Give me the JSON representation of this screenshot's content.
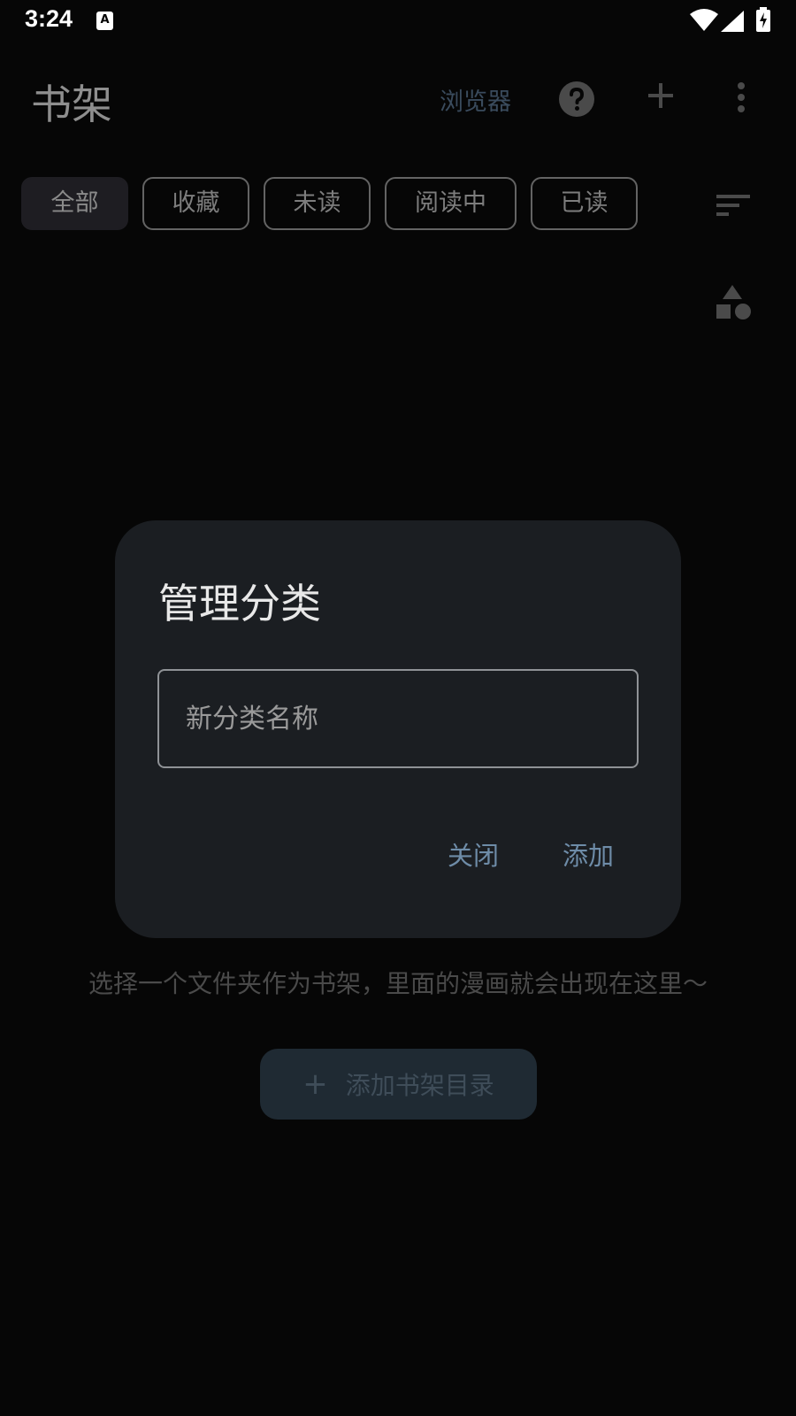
{
  "status_bar": {
    "time": "3:24",
    "notification_icon_letter": "A"
  },
  "app_bar": {
    "title": "书架",
    "browser_label": "浏览器",
    "icons": [
      "help-icon",
      "add-icon",
      "more-vert-icon"
    ]
  },
  "filters": {
    "chips": [
      {
        "label": "全部",
        "selected": true
      },
      {
        "label": "收藏",
        "selected": false
      },
      {
        "label": "未读",
        "selected": false
      },
      {
        "label": "阅读中",
        "selected": false
      },
      {
        "label": "已读",
        "selected": false
      }
    ]
  },
  "empty_state": {
    "description": "选择一个文件夹作为书架，里面的漫画就会出现在这里～",
    "add_button_label": "添加书架目录"
  },
  "dialog": {
    "title": "管理分类",
    "input_placeholder": "新分类名称",
    "input_value": "",
    "close_label": "关闭",
    "add_label": "添加"
  },
  "colors": {
    "background": "#060606",
    "dialog_bg": "#1b1e22",
    "dialog_button_text": "#6e8ca8",
    "selected_chip_bg": "#1e1d22"
  }
}
